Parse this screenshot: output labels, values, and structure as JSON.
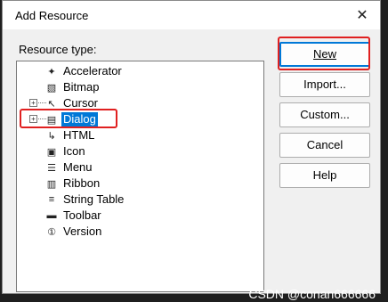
{
  "dialog": {
    "title": "Add Resource",
    "close_icon": "close-icon"
  },
  "resource_type_label": "Resource type:",
  "tree": {
    "items": [
      {
        "label": "Accelerator",
        "icon": "accelerator-icon",
        "expandable": false,
        "selected": false,
        "glyph": "✦"
      },
      {
        "label": "Bitmap",
        "icon": "bitmap-icon",
        "expandable": false,
        "selected": false,
        "glyph": "▧"
      },
      {
        "label": "Cursor",
        "icon": "cursor-icon",
        "expandable": true,
        "selected": false,
        "glyph": "↖"
      },
      {
        "label": "Dialog",
        "icon": "dialog-icon",
        "expandable": true,
        "selected": true,
        "glyph": "▤"
      },
      {
        "label": "HTML",
        "icon": "html-icon",
        "expandable": false,
        "selected": false,
        "glyph": "↳"
      },
      {
        "label": "Icon",
        "icon": "icon-resource-icon",
        "expandable": false,
        "selected": false,
        "glyph": "▣"
      },
      {
        "label": "Menu",
        "icon": "menu-icon",
        "expandable": false,
        "selected": false,
        "glyph": "☰"
      },
      {
        "label": "Ribbon",
        "icon": "ribbon-icon",
        "expandable": false,
        "selected": false,
        "glyph": "▥"
      },
      {
        "label": "String Table",
        "icon": "string-table-icon",
        "expandable": false,
        "selected": false,
        "glyph": "≡"
      },
      {
        "label": "Toolbar",
        "icon": "toolbar-icon",
        "expandable": false,
        "selected": false,
        "glyph": "▬"
      },
      {
        "label": "Version",
        "icon": "version-icon",
        "expandable": false,
        "selected": false,
        "glyph": "①"
      }
    ]
  },
  "buttons": {
    "new": "New",
    "import": "Import...",
    "custom": "Custom...",
    "cancel": "Cancel",
    "help": "Help"
  },
  "watermark": "CSDN @conan666666",
  "colors": {
    "selection": "#0078d7",
    "highlight": "#e02020"
  }
}
